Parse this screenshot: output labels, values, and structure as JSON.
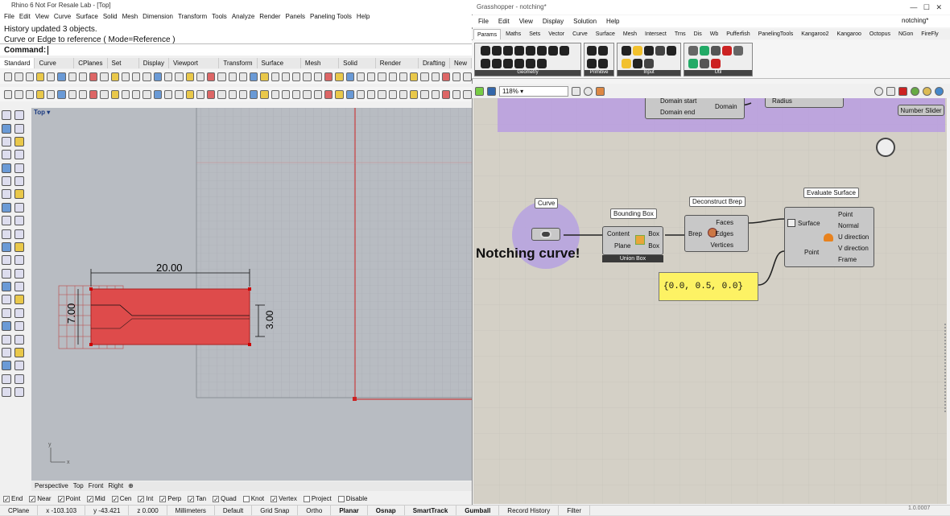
{
  "rhino": {
    "title": "Rhino 6 Not For Resale Lab - [Top]",
    "menu": [
      "File",
      "Edit",
      "View",
      "Curve",
      "Surface",
      "Solid",
      "Mesh",
      "Dimension",
      "Transform",
      "Tools",
      "Analyze",
      "Render",
      "Panels",
      "Paneling Tools",
      "Help"
    ],
    "history": [
      "History updated 3 objects.",
      "Curve or Edge to reference ( Mode=Reference )"
    ],
    "command_label": "Command:",
    "tabs": [
      "Standard",
      "Curve Tools",
      "CPlanes",
      "Set View",
      "Display",
      "Viewport Layout",
      "Transform",
      "Surface Tools",
      "Mesh Tools",
      "Solid Tools",
      "Render Tools",
      "Drafting",
      "New"
    ],
    "viewport_label": "Top",
    "dims": {
      "width": "20.00",
      "height": "7.00",
      "small": "3.00"
    },
    "view_tabs": [
      "Perspective",
      "Top",
      "Front",
      "Right"
    ],
    "snaps": [
      {
        "label": "End",
        "on": true
      },
      {
        "label": "Near",
        "on": true
      },
      {
        "label": "Point",
        "on": true
      },
      {
        "label": "Mid",
        "on": true
      },
      {
        "label": "Cen",
        "on": true
      },
      {
        "label": "Int",
        "on": true
      },
      {
        "label": "Perp",
        "on": true
      },
      {
        "label": "Tan",
        "on": true
      },
      {
        "label": "Quad",
        "on": true
      },
      {
        "label": "Knot",
        "on": false
      },
      {
        "label": "Vertex",
        "on": true
      },
      {
        "label": "Project",
        "on": false
      },
      {
        "label": "Disable",
        "on": false
      }
    ],
    "status": [
      "CPlane",
      "x -103.103",
      "y -43.421",
      "z 0.000",
      "Millimeters",
      "Default",
      "Grid Snap",
      "Ortho",
      "Planar",
      "Osnap",
      "SmartTrack",
      "Gumball",
      "Record History",
      "Filter"
    ]
  },
  "gh": {
    "title": "Grasshopper - notching*",
    "doc": "notching*",
    "menu": [
      "File",
      "Edit",
      "View",
      "Display",
      "Solution",
      "Help"
    ],
    "tabs": [
      "Params",
      "Maths",
      "Sets",
      "Vector",
      "Curve",
      "Surface",
      "Mesh",
      "Intersect",
      "Trns",
      "Dis",
      "Wb",
      "Pufferfish",
      "PanelingTools",
      "Kangaroo2",
      "Kangaroo",
      "Octopus",
      "NGon",
      "FireFly"
    ],
    "groups": [
      "Geometry",
      "Primitive",
      "Input",
      "Util"
    ],
    "zoom": "118%",
    "nodes": {
      "domain_start": "Domain start",
      "domain_end": "Domain end",
      "domain": "Domain",
      "radius": "Radius",
      "slider": "Number Slider",
      "curve": "Curve",
      "bbox_title": "Bounding Box",
      "bbox_in": [
        "Content",
        "Plane"
      ],
      "bbox_out": [
        "Box",
        "Box"
      ],
      "bbox_foot": "Union Box",
      "dbrep_title": "Deconstruct Brep",
      "dbrep_in": "Brep",
      "dbrep_out": [
        "Faces",
        "Edges",
        "Vertices"
      ],
      "esurf_title": "Evaluate Surface",
      "esurf_in": [
        "Surface",
        "Point"
      ],
      "esurf_out": [
        "Point",
        "Normal",
        "U direction",
        "V direction",
        "Frame"
      ],
      "panel": "{0.0, 0.5, 0.0}",
      "note": "Notching curve!"
    },
    "version": "1.0.0007"
  }
}
